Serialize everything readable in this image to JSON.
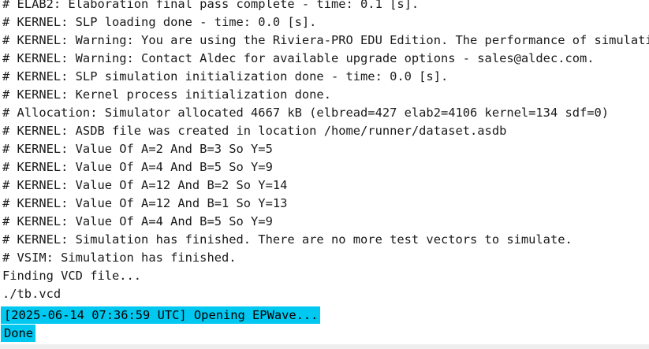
{
  "console": {
    "lines": [
      "# ELAB2: Elaboration final pass complete - time: 0.1 [s].",
      "# KERNEL: SLP loading done - time: 0.0 [s].",
      "# KERNEL: Warning: You are using the Riviera-PRO EDU Edition. The performance of simulation",
      "# KERNEL: Warning: Contact Aldec for available upgrade options - sales@aldec.com.",
      "# KERNEL: SLP simulation initialization done - time: 0.0 [s].",
      "# KERNEL: Kernel process initialization done.",
      "# Allocation: Simulator allocated 4667 kB (elbread=427 elab2=4106 kernel=134 sdf=0)",
      "# KERNEL: ASDB file was created in location /home/runner/dataset.asdb",
      "# KERNEL: Value Of A=2 And B=3 So Y=5",
      "# KERNEL: Value Of A=4 And B=5 So Y=9",
      "# KERNEL: Value Of A=12 And B=2 So Y=14",
      "# KERNEL: Value Of A=12 And B=1 So Y=13",
      "# KERNEL: Value Of A=4 And B=5 So Y=9",
      "# KERNEL: Simulation has finished. There are no more test vectors to simulate.",
      "# VSIM: Simulation has finished.",
      "Finding VCD file...",
      "./tb.vcd"
    ],
    "highlighted": [
      "[2025-06-14 07:36:59 UTC] Opening EPWave...",
      "Done"
    ],
    "highlight_color": "#00c8f0",
    "text_color": "#1a1a1a",
    "background_color": "#ffffff"
  }
}
